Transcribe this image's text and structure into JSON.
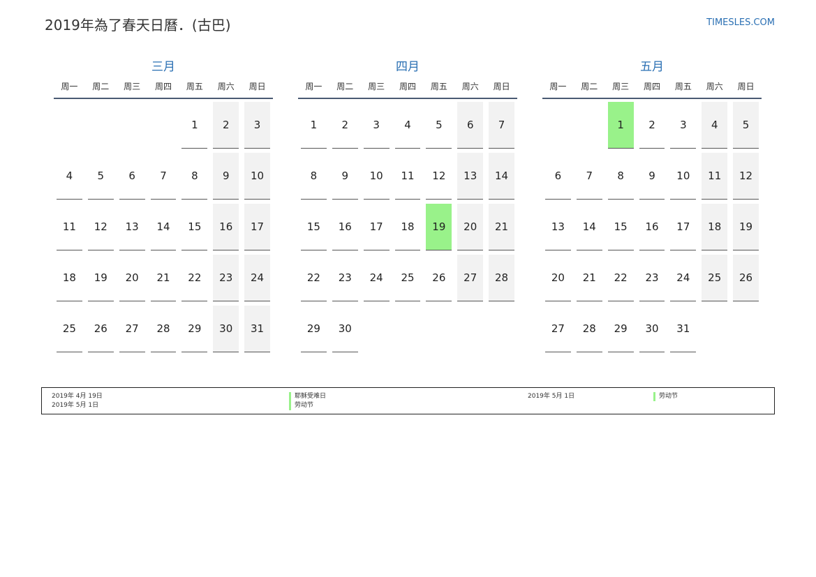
{
  "header": {
    "title": "2019年為了春天日曆．(古巴)",
    "site": "TIMESLES.COM"
  },
  "weekdays": [
    "周一",
    "周二",
    "周三",
    "周四",
    "周五",
    "周六",
    "周日"
  ],
  "months": [
    {
      "name": "三月",
      "weeks": [
        [
          "",
          "",
          "",
          "",
          "1",
          "2",
          "3"
        ],
        [
          "4",
          "5",
          "6",
          "7",
          "8",
          "9",
          "10"
        ],
        [
          "11",
          "12",
          "13",
          "14",
          "15",
          "16",
          "17"
        ],
        [
          "18",
          "19",
          "20",
          "21",
          "22",
          "23",
          "24"
        ],
        [
          "25",
          "26",
          "27",
          "28",
          "29",
          "30",
          "31"
        ]
      ],
      "holidays": []
    },
    {
      "name": "四月",
      "weeks": [
        [
          "1",
          "2",
          "3",
          "4",
          "5",
          "6",
          "7"
        ],
        [
          "8",
          "9",
          "10",
          "11",
          "12",
          "13",
          "14"
        ],
        [
          "15",
          "16",
          "17",
          "18",
          "19",
          "20",
          "21"
        ],
        [
          "22",
          "23",
          "24",
          "25",
          "26",
          "27",
          "28"
        ],
        [
          "29",
          "30",
          "",
          "",
          "",
          "",
          ""
        ]
      ],
      "holidays": [
        "19"
      ]
    },
    {
      "name": "五月",
      "weeks": [
        [
          "",
          "",
          "1",
          "2",
          "3",
          "4",
          "5"
        ],
        [
          "6",
          "7",
          "8",
          "9",
          "10",
          "11",
          "12"
        ],
        [
          "13",
          "14",
          "15",
          "16",
          "17",
          "18",
          "19"
        ],
        [
          "20",
          "21",
          "22",
          "23",
          "24",
          "25",
          "26"
        ],
        [
          "27",
          "28",
          "29",
          "30",
          "31",
          "",
          ""
        ]
      ],
      "holidays": [
        "1"
      ]
    }
  ],
  "legend": {
    "holiday_color": "#99f28a",
    "left": [
      {
        "date": "2019年 4月 19日",
        "name": "耶稣受难日"
      },
      {
        "date": "2019年 5月 1日",
        "name": "劳动节"
      }
    ],
    "right": [
      {
        "date": "2019年 5月 1日",
        "name": "劳动节"
      }
    ]
  }
}
